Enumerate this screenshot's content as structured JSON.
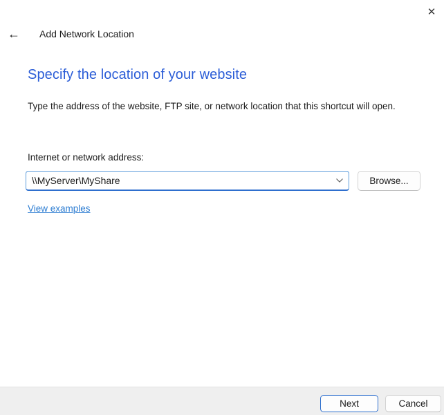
{
  "window": {
    "title": "Add Network Location"
  },
  "icons": {
    "close": "✕",
    "back": "←"
  },
  "main": {
    "heading": "Specify the location of your website",
    "description": "Type the address of the website, FTP site, or network location that this shortcut will open.",
    "address": {
      "label": "Internet or network address:",
      "value": "\\\\MyServer\\MyShare",
      "browse_label": "Browse...",
      "chevron_icon_name": "chevron-down-icon"
    },
    "examples_link_label": "View examples"
  },
  "footer": {
    "next_label": "Next",
    "cancel_label": "Cancel"
  },
  "colors": {
    "heading_blue": "#2b5dd7",
    "link_blue": "#2d7dd2",
    "accent_border": "#2e6fce",
    "focus_border_light": "#5b9bdb",
    "footer_bg": "#efefef",
    "divider": "#e2e2e2",
    "button_border": "#d2d2d2",
    "button_bg": "#fdfdfd",
    "text_dark": "#1b1b1b"
  }
}
